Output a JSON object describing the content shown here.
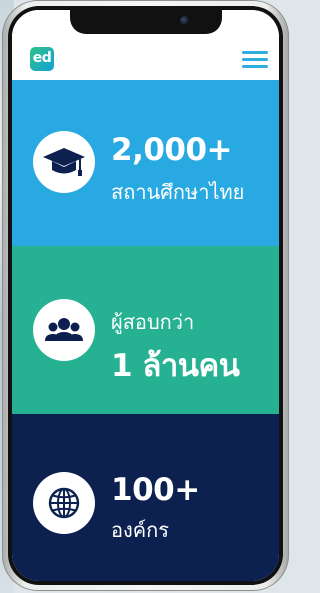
{
  "header": {
    "logo_text": "ed",
    "menu_icon": "hamburger-menu-icon"
  },
  "stats": [
    {
      "icon": "graduation-cap-icon",
      "value": "2,000+",
      "caption": "สถานศึกษาไทย",
      "color": "#28a9e2"
    },
    {
      "icon": "people-group-icon",
      "caption": "ผู้สอบกว่า",
      "value": "1 ล้านคน",
      "color": "#25b192"
    },
    {
      "icon": "globe-icon",
      "value": "100+",
      "caption": "องค์กร",
      "color": "#0d2150"
    }
  ],
  "colors": {
    "accent": "#2eaee0",
    "icon": "#0d2150"
  }
}
